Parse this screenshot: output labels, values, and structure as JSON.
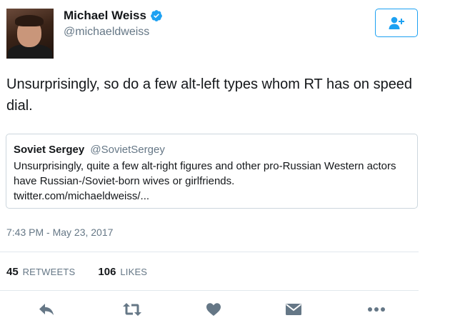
{
  "author": {
    "name": "Michael Weiss",
    "handle": "@michaeldweiss",
    "verified": true,
    "avatar_icon": "avatar"
  },
  "follow_button": {
    "icon": "follow-user-icon",
    "color": "#1da1f2"
  },
  "tweet": {
    "text": "Unsurprisingly, so do a few alt-left types whom RT has on speed dial."
  },
  "quoted_tweet": {
    "name": "Soviet Sergey",
    "handle": "@SovietSergey",
    "text": "Unsurprisingly, quite a few alt-right figures and other pro-Russian Western actors have Russian-/Soviet-born wives or girlfriends.",
    "link": "twitter.com/michaeldweiss/..."
  },
  "timestamp": "7:43 PM - May 23, 2017",
  "stats": {
    "retweets_count": "45",
    "retweets_label": "RETWEETS",
    "likes_count": "106",
    "likes_label": "LIKES"
  },
  "actions": [
    {
      "icon": "reply-icon"
    },
    {
      "icon": "retweet-icon"
    },
    {
      "icon": "like-icon"
    },
    {
      "icon": "direct-message-icon"
    },
    {
      "icon": "more-icon"
    }
  ],
  "colors": {
    "accent": "#1da1f2",
    "text": "#14171a",
    "secondary": "#657786",
    "icon": "#657786",
    "border": "#ccd6dd"
  }
}
